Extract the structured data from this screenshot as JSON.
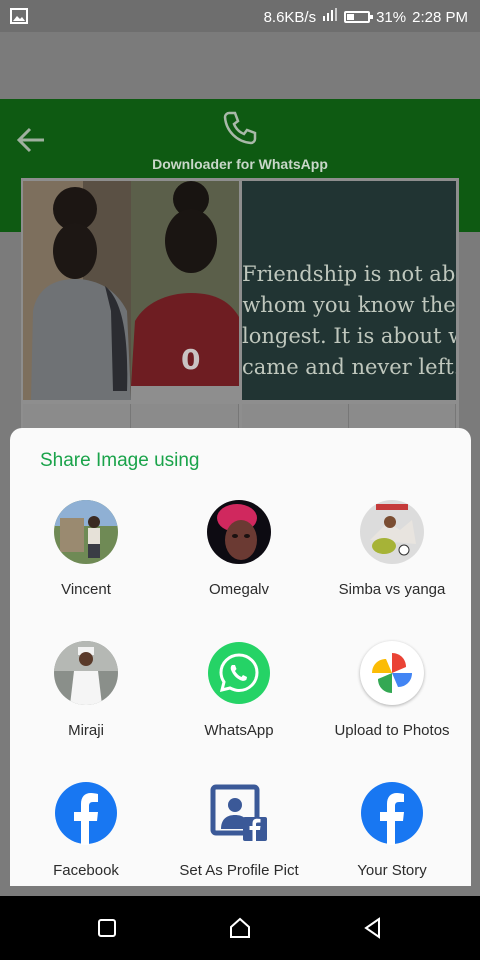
{
  "status_bar": {
    "net_speed": "8.6KB/s",
    "battery": "31%",
    "time": "2:28 PM",
    "icons": [
      "image-icon",
      "signal-icon",
      "battery-icon"
    ]
  },
  "app": {
    "title": "Downloader for WhatsApp",
    "quote": [
      "Friendship is not about",
      "whom you know the",
      "longest. It is about who",
      "came and never left."
    ],
    "jersey_number": "0",
    "colors": {
      "toolbar": "#0e5a12",
      "scrim": "#7b7b7b"
    }
  },
  "share_sheet": {
    "title": "Share Image using",
    "targets": [
      {
        "label": "Vincent",
        "icon": "contact-avatar"
      },
      {
        "label": "Omegalv",
        "icon": "contact-avatar"
      },
      {
        "label": "Simba vs yanga",
        "icon": "contact-avatar"
      },
      {
        "label": "Miraji",
        "icon": "contact-avatar"
      },
      {
        "label": "WhatsApp",
        "icon": "whatsapp-icon"
      },
      {
        "label": "Upload to Photos",
        "icon": "google-photos-icon"
      },
      {
        "label": "Facebook",
        "icon": "facebook-icon"
      },
      {
        "label": "Set As Profile Pict",
        "icon": "profile-picture-icon"
      },
      {
        "label": "Your Story",
        "icon": "facebook-icon"
      }
    ],
    "colors": {
      "title": "#1aa34a",
      "whatsapp": "#25d366",
      "facebook": "#1877f2"
    }
  },
  "nav_bar": {
    "buttons": [
      "recents-button",
      "home-button",
      "back-button"
    ]
  }
}
